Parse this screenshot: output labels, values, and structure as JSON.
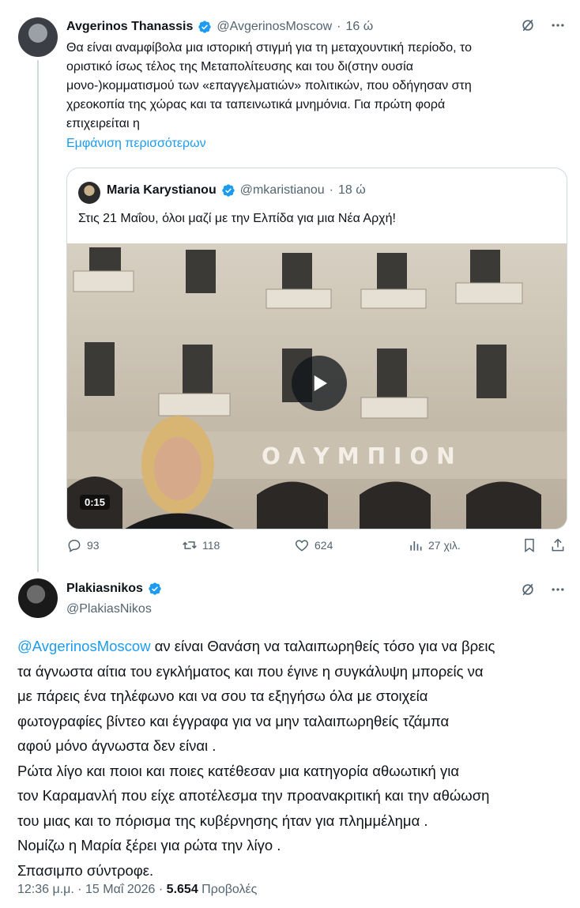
{
  "tweet1": {
    "author_name": "Avgerinos Thanassis",
    "handle": "@AvgerinosMoscow",
    "separator": "·",
    "time": "16 ώ",
    "lines": [
      "Θα είναι αναμφίβολα μια ιστορική στιγμή για τη μεταχουντική περίοδο, το",
      "οριστικό ίσως τέλος της Μεταπολίτευσης και του δι(στην ουσία",
      "μονο-)κομματισμού των «επαγγελματιών» πολιτικών, που οδήγησαν στη",
      "χρεοκοπία της χώρας και τα ταπεινωτικά μνημόνια. Για πρώτη φορά",
      "επιχειρείται η"
    ],
    "show_more": "Εμφάνιση περισσότερων",
    "quote": {
      "author_name": "Maria Karystianou",
      "handle": "@mkaristianou",
      "separator": "·",
      "time": "18 ώ",
      "text": "Στις 21 Μαΐου, όλοι μαζί με την Ελπίδα για μια Νέα Αρχή!",
      "video_sign": "ΟΛΥΜΠΙΟΝ",
      "video_duration": "0:15"
    },
    "actions": {
      "replies": "93",
      "reposts": "118",
      "likes": "624",
      "views": "27 χιλ."
    }
  },
  "tweet2": {
    "author_name": "Plakiasnikos",
    "handle": "@PlakiasNikos",
    "mention": "@AvgerinosMoscow",
    "lines": [
      " αν είναι Θανάση να ταλαιπωρηθείς τόσο για να βρεις",
      "τα άγνωστα αίτια του εγκλήματος και που έγινε η συγκάλυψη μπορείς να",
      "με πάρεις ένα τηλέφωνο και να σου τα εξηγήσω όλα με στοιχεία",
      "φωτογραφίες βίντεο και έγγραφα για να μην ταλαιπωρηθείς τζάμπα",
      "αφού μόνο άγνωστα δεν είναι .",
      "Ρώτα λίγο και ποιοι και  ποιες κατέθεσαν μια κατηγορία αθωωτική για",
      "τον Καραμανλή που είχε αποτέλεσμα την προανακριτική και την αθώωση",
      "του μιας και το πόρισμα της κυβέρνησης ήταν για πλημμέλημα .",
      "Νομίζω η Μαρία ξέρει για ρώτα  την λίγο .",
      "Σπασιμπο σύντροφε."
    ],
    "timestamp": "12:36 μ.μ. · 15 Μαΐ 2026 · ",
    "views_count": "5.654",
    "views_label": " Προβολές"
  },
  "colors": {
    "accent": "#1d9bf0",
    "text": "#0f1419",
    "secondary": "#536471",
    "border": "#cfd9de"
  },
  "icons": [
    "verified-badge-icon",
    "grok-icon",
    "more-icon",
    "play-icon",
    "reply-icon",
    "repost-icon",
    "like-icon",
    "views-icon",
    "bookmark-icon",
    "share-icon"
  ]
}
